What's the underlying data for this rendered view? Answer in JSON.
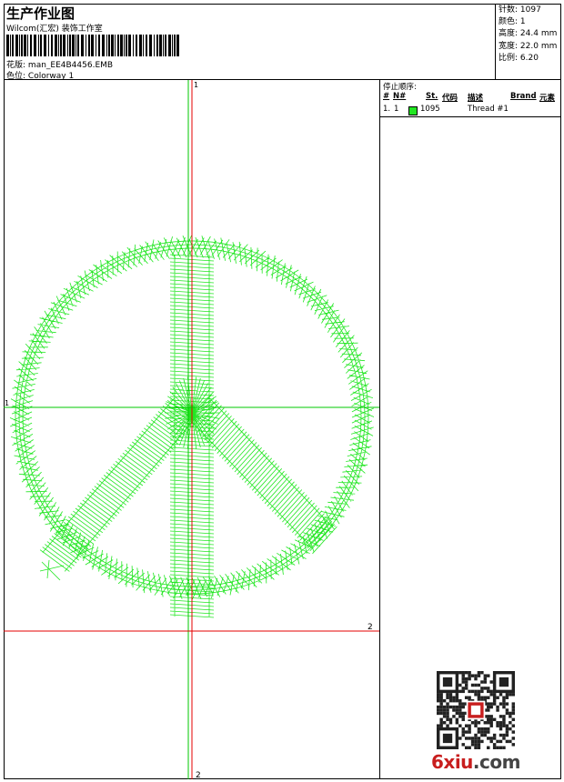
{
  "header": {
    "title": "生产作业图",
    "studio": "Wilcom(汇宏) 装饰工作室",
    "design_label": "花版:",
    "design_value": "man_EE4B4456.EMB",
    "colorway_label": "色位:",
    "colorway_value": "Colorway 1"
  },
  "stats": [
    {
      "label": "针数:",
      "value": "1097"
    },
    {
      "label": "颜色:",
      "value": "1"
    },
    {
      "label": "高度:",
      "value": "24.4 mm"
    },
    {
      "label": "宽度:",
      "value": "22.0 mm"
    },
    {
      "label": "比例:",
      "value": "6.20"
    }
  ],
  "canvas": {
    "axis_top": "1",
    "axis_left": "1",
    "axis_right": "2",
    "axis_bottom": "2",
    "stitch_color": "#22e622",
    "axis_red": "#e60000",
    "axis_green": "#00c800"
  },
  "stop_sequence": {
    "title": "停止顺序:",
    "headers": [
      "#",
      "N#",
      "St.",
      "代码",
      "描述",
      "Brand",
      "元素"
    ],
    "rows": [
      {
        "num": "1.",
        "n": "1",
        "color": "#22e622",
        "code": "1095",
        "desc": "Thread #1"
      }
    ]
  },
  "watermark": {
    "part_a": "6xiu",
    "part_b": ".com"
  }
}
